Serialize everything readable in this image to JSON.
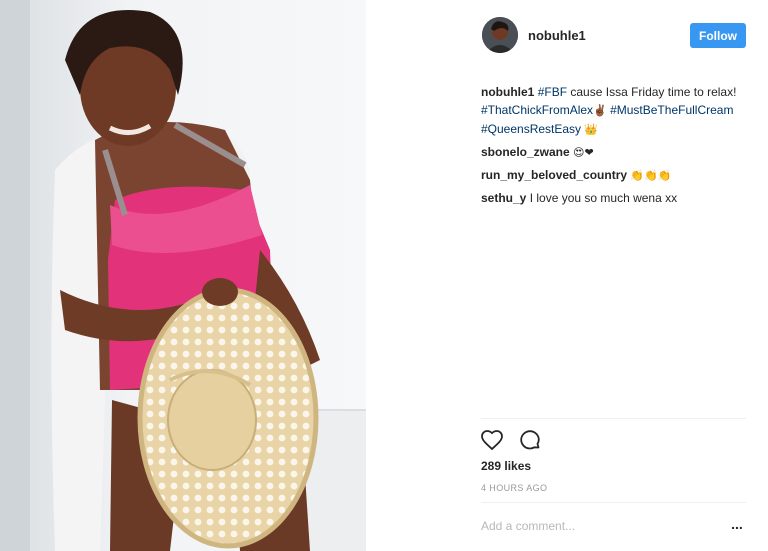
{
  "header": {
    "username": "nobuhle1",
    "follow_label": "Follow"
  },
  "caption": {
    "user": "nobuhle1",
    "hashtag1": "#FBF",
    "text1": "cause Issa Friday time to relax!",
    "hashtag2": "#ThatChickFromAlex",
    "emoji1": "✌🏾",
    "hashtag3": "#MustBeTheFullCream",
    "hashtag4": "#QueensRestEasy",
    "emoji2": "👑"
  },
  "comments": [
    {
      "user": "sbonelo_zwane",
      "text": "",
      "emoji": "😍❤"
    },
    {
      "user": "run_my_beloved_country",
      "text": "",
      "emoji": "👏👏👏"
    },
    {
      "user": "sethu_y",
      "text": "I love you so much wena xx",
      "emoji": ""
    }
  ],
  "actions": {
    "like_icon": "heart-icon",
    "comment_icon": "comment-icon"
  },
  "likes": "289 likes",
  "timestamp": "4 HOURS AGO",
  "add_comment_placeholder": "Add a comment...",
  "more_label": "..."
}
